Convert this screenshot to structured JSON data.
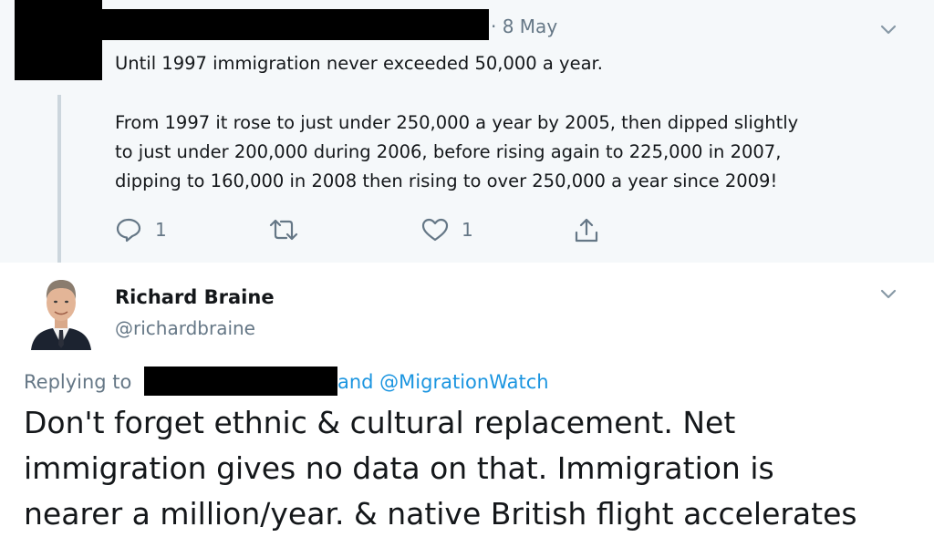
{
  "parent_tweet": {
    "date_separator": "·",
    "date": "8 May",
    "paragraph1": "Until 1997 immigration never exceeded 50,000 a year.",
    "paragraph2_line1": "From 1997 it rose to just under 250,000 a year by 2005, then dipped slightly",
    "paragraph2_line2": "to just under 200,000 during 2006, before rising again to 225,000 in 2007,",
    "paragraph2_line3": "dipping to 160,000 in 2008 then rising to over 250,000 a year since 2009!",
    "reply_count": "1",
    "like_count": "1",
    "icons": [
      "chevron-down-icon",
      "reply-icon",
      "retweet-icon",
      "like-icon",
      "share-icon"
    ]
  },
  "reply_tweet": {
    "author_name": "Richard Braine",
    "author_handle": "@richardbraine",
    "replying_prefix": "Replying to",
    "replying_suffix": "and @MigrationWatch",
    "line1": "Don't forget ethnic & cultural replacement. Net",
    "line2": "immigration gives no data on that. Immigration is",
    "line3": "nearer a million/year. & native British flight accelerates"
  },
  "colors": {
    "parent_bg": "#f5f8fa",
    "text": "#14171a",
    "muted": "#657786",
    "link": "#1b95e0",
    "redaction": "#000000"
  }
}
